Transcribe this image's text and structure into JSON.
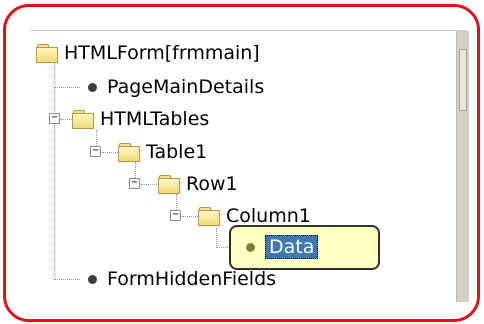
{
  "tree": {
    "root": {
      "label": "HTMLForm[frmmain]",
      "icon": "folder-icon"
    },
    "page_main_details": {
      "label": "PageMainDetails",
      "icon": "bullet-icon"
    },
    "html_tables": {
      "label": "HTMLTables",
      "icon": "folder-icon",
      "toggle": "−",
      "expanded": true
    },
    "table1": {
      "label": "Table1",
      "icon": "folder-icon",
      "toggle": "−",
      "expanded": true
    },
    "row1": {
      "label": "Row1",
      "icon": "folder-icon",
      "toggle": "−",
      "expanded": true
    },
    "column1": {
      "label": "Column1",
      "icon": "folder-icon",
      "toggle": "−",
      "expanded": true
    },
    "data": {
      "label": "Data",
      "icon": "bullet-icon",
      "selected": true
    },
    "form_hidden_fields": {
      "label": "FormHiddenFields",
      "icon": "bullet-icon"
    }
  },
  "colors": {
    "frame_border": "#e3101a",
    "callout_fill": "#ffffc4",
    "selection": "#3d78b0"
  }
}
